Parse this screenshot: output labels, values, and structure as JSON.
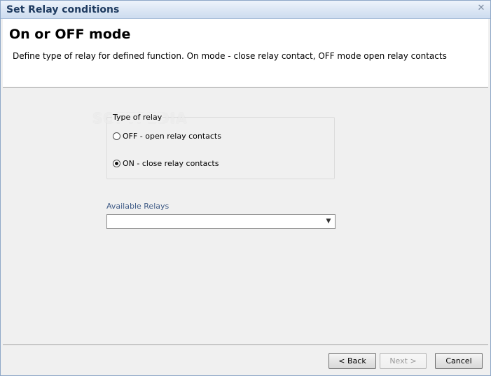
{
  "window": {
    "title": "Set Relay conditions",
    "close_glyph": "✕"
  },
  "header": {
    "title": "On or OFF mode",
    "description": "Define type of relay for defined function. On mode - close relay contact, OFF mode open relay contacts"
  },
  "watermark": "SOFTPEDIA",
  "relay_type": {
    "group_label": "Type of relay",
    "options": [
      {
        "label": "OFF - open relay contacts",
        "checked": false
      },
      {
        "label": "ON - close relay contacts",
        "checked": true
      }
    ]
  },
  "relays": {
    "label": "Available Relays",
    "selected": ""
  },
  "footer": {
    "back_label": "< Back",
    "next_label": "Next >",
    "cancel_label": "Cancel"
  },
  "colors": {
    "title_text": "#1e3a5f",
    "label_blue": "#3e5a86",
    "border": "#8ea7c7"
  }
}
